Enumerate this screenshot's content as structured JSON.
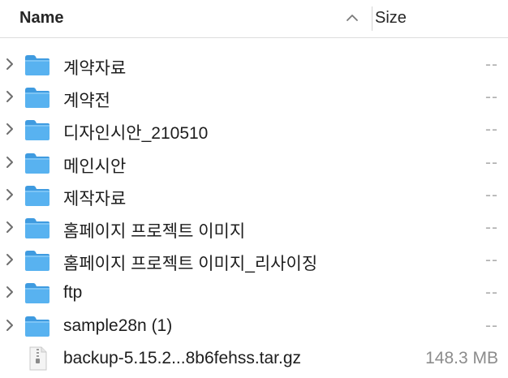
{
  "header": {
    "name_label": "Name",
    "size_label": "Size",
    "sort": "ascending"
  },
  "rows": [
    {
      "name": "계약자료",
      "size": "--",
      "kind": "folder"
    },
    {
      "name": "계약전",
      "size": "--",
      "kind": "folder"
    },
    {
      "name": "디자인시안_210510",
      "size": "--",
      "kind": "folder"
    },
    {
      "name": "메인시안",
      "size": "--",
      "kind": "folder"
    },
    {
      "name": "제작자료",
      "size": "--",
      "kind": "folder"
    },
    {
      "name": "홈페이지 프로젝트 이미지",
      "size": "--",
      "kind": "folder"
    },
    {
      "name": "홈페이지 프로젝트 이미지_리사이징",
      "size": "--",
      "kind": "folder"
    },
    {
      "name": "ftp",
      "size": "--",
      "kind": "folder"
    },
    {
      "name": "sample28n (1)",
      "size": "--",
      "kind": "folder"
    },
    {
      "name": "backup-5.15.2...8b6fehss.tar.gz",
      "size": "148.3 MB",
      "kind": "archive"
    }
  ],
  "icons": {
    "folder": "folder-icon",
    "archive": "archive-file-icon",
    "disclosure": "chevron-right-icon",
    "sort": "chevron-up-icon"
  },
  "colors": {
    "folder_body": "#58b2f0",
    "folder_tab": "#3f9be0",
    "muted_text": "#8c8c8c"
  }
}
